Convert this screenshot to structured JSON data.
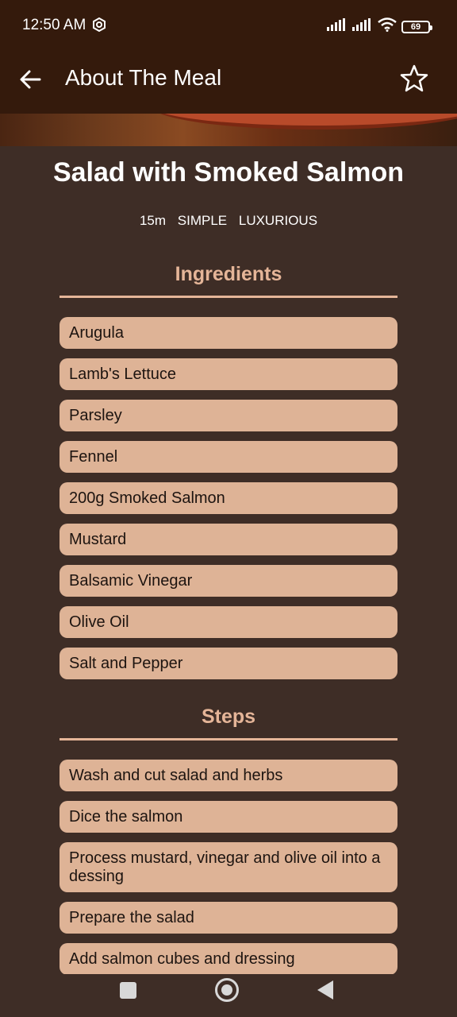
{
  "status": {
    "time": "12:50 AM",
    "battery": "69",
    "icons": [
      "settings-icon",
      "signal-icon",
      "signal-icon",
      "wifi-icon",
      "battery-icon"
    ]
  },
  "app_bar": {
    "title": "About The Meal",
    "back_icon": "arrow-left-icon",
    "favorite_icon": "star-outline-icon"
  },
  "meal": {
    "title": "Salad with Smoked Salmon",
    "duration": "15m",
    "complexity": "SIMPLE",
    "affordability": "LUXURIOUS"
  },
  "ingredients": {
    "title": "Ingredients",
    "items": [
      "Arugula",
      "Lamb's Lettuce",
      "Parsley",
      "Fennel",
      "200g Smoked Salmon",
      "Mustard",
      "Balsamic Vinegar",
      "Olive Oil",
      "Salt and Pepper"
    ]
  },
  "steps": {
    "title": "Steps",
    "items": [
      "Wash and cut salad and herbs",
      "Dice the salmon",
      "Process mustard, vinegar and olive oil into a dessing",
      "Prepare the salad",
      "Add salmon cubes and dressing"
    ]
  },
  "colors": {
    "app_bar": "#341a0c",
    "background": "#3e2d26",
    "accent": "#e5b598",
    "card": "#deb396"
  }
}
